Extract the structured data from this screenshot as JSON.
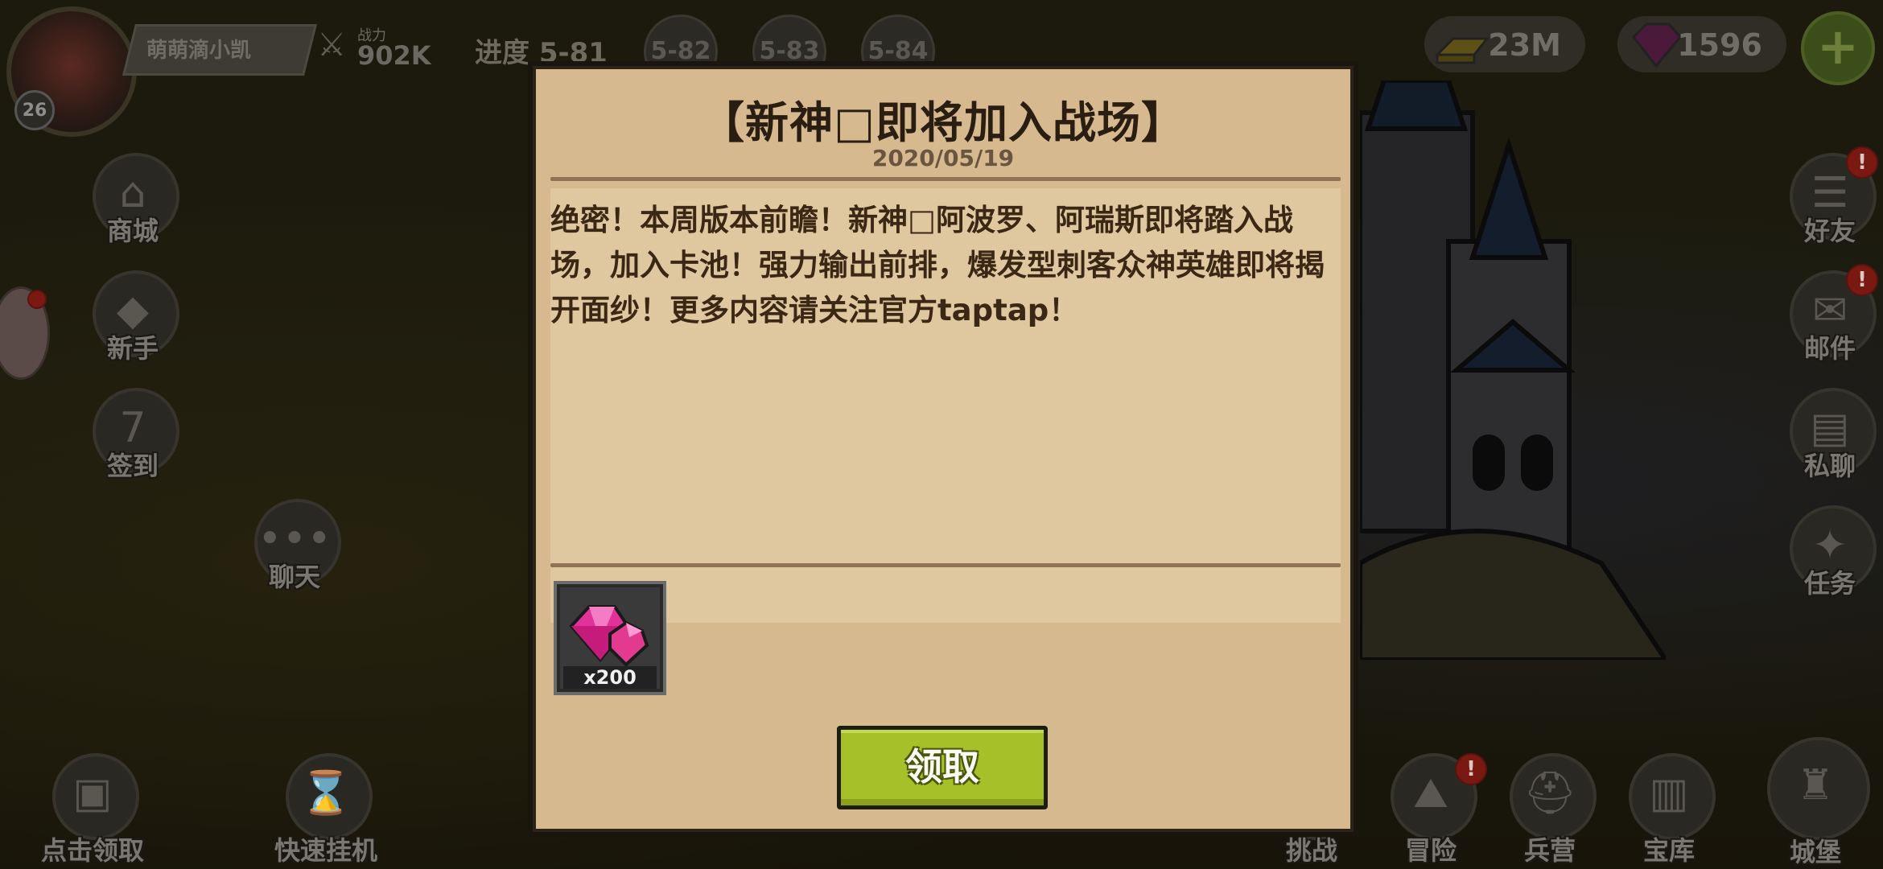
{
  "player": {
    "name": "萌萌滴小凯",
    "level": "26",
    "power_label": "战力",
    "power_value": "902K"
  },
  "progress": {
    "label": "进度 5-81",
    "nodes": [
      "5-82",
      "5-83",
      "5-84"
    ]
  },
  "currencies": {
    "gold": "23M",
    "gems": "1596",
    "add_symbol": "+"
  },
  "left_menu": [
    {
      "label": "商城",
      "icon": "shop-icon"
    },
    {
      "label": "新手",
      "icon": "beginner-icon"
    },
    {
      "label": "签到",
      "icon": "calendar-icon"
    },
    {
      "label": "聊天",
      "icon": "chat-icon"
    }
  ],
  "right_menu": [
    {
      "label": "好友",
      "icon": "friends-icon",
      "badge": "!"
    },
    {
      "label": "邮件",
      "icon": "mail-icon",
      "badge": "!"
    },
    {
      "label": "私聊",
      "icon": "private-chat-icon"
    },
    {
      "label": "任务",
      "icon": "quest-icon"
    }
  ],
  "bottom_bar": {
    "left_items": [
      "点击领取",
      "快速挂机"
    ],
    "right_items": [
      "挑战",
      "冒险",
      "兵营",
      "宝库",
      "城堡"
    ],
    "adventure_badge": "!"
  },
  "modal": {
    "title": "【新神□即将加入战场】",
    "date": "2020/05/19",
    "body": "绝密！本周版本前瞻！新神□阿波罗、阿瑞斯即将踏入战场，加入卡池！强力输出前排，爆发型刺客众神英雄即将揭开面纱！更多内容请关注官方taptap！",
    "reward": {
      "icon": "gem-icon",
      "count": "x200"
    },
    "claim_label": "领取"
  },
  "colors": {
    "panel": "#d6b98f",
    "button": "#a6c02a",
    "gem": "#e2329a"
  }
}
